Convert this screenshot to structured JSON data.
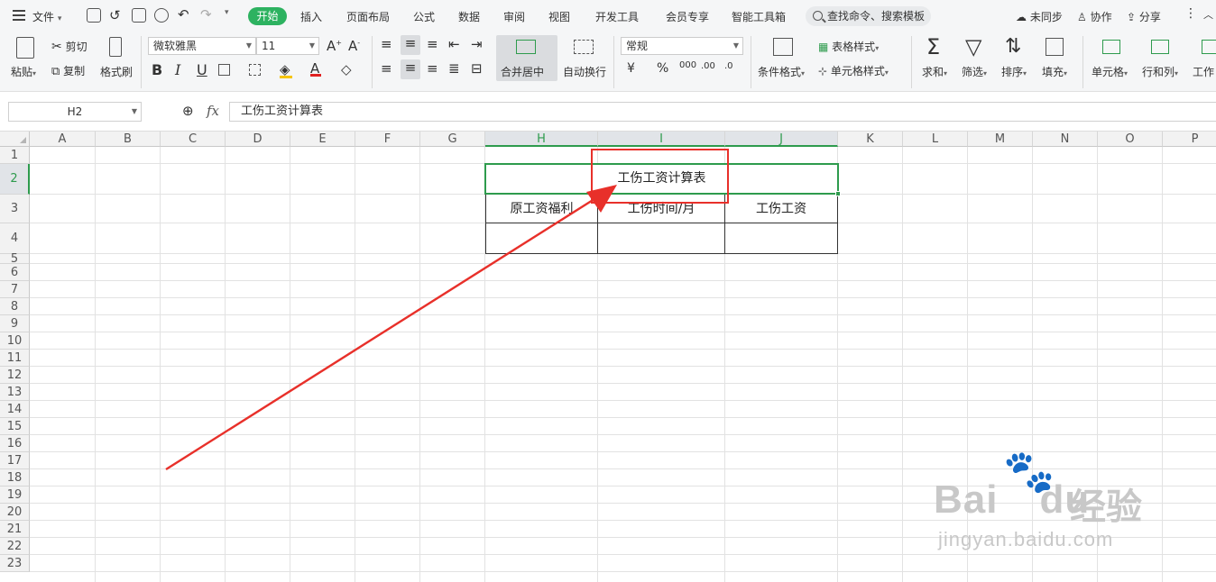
{
  "topbar": {
    "file_label": "文件",
    "tabs": [
      "开始",
      "插入",
      "页面布局",
      "公式",
      "数据",
      "审阅",
      "视图",
      "开发工具",
      "会员专享",
      "智能工具箱"
    ],
    "search_placeholder": "查找命令、搜索模板",
    "sync_label": "未同步",
    "collab_label": "协作",
    "share_label": "分享"
  },
  "ribbon": {
    "paste": "粘贴",
    "cut": "剪切",
    "copy": "复制",
    "format_painter": "格式刷",
    "font_name": "微软雅黑",
    "font_size": "11",
    "bold": "B",
    "italic": "I",
    "underline": "U",
    "merge_center": "合并居中",
    "wrap_text": "自动换行",
    "number_format": "常规",
    "currency": "¥",
    "percent": "%",
    "thousands": "000",
    "inc_decimal": ".00",
    "dec_decimal": ".0",
    "conditional_format": "条件格式",
    "table_style": "表格样式",
    "cell_style": "单元格样式",
    "sum": "求和",
    "filter": "筛选",
    "sort": "排序",
    "fill": "填充",
    "cell": "单元格",
    "row_col": "行和列",
    "worksheet": "工作"
  },
  "formula_bar": {
    "name_box": "H2",
    "fx": "fx",
    "value": "工伤工资计算表"
  },
  "sheet": {
    "columns": [
      "A",
      "B",
      "C",
      "D",
      "E",
      "F",
      "G",
      "H",
      "I",
      "J",
      "K",
      "L",
      "M",
      "N",
      "O",
      "P"
    ],
    "rows": [
      "1",
      "2",
      "3",
      "4",
      "5",
      "6",
      "7",
      "8",
      "9",
      "10",
      "11",
      "12",
      "13",
      "14",
      "15",
      "16",
      "17",
      "18",
      "19",
      "20",
      "21",
      "22",
      "23"
    ],
    "title_cell": "工伤工资计算表",
    "headers": [
      "原工资福利",
      "工伤时间/月",
      "工伤工资"
    ]
  },
  "watermark": {
    "brand_a": "Bai",
    "brand_b": "du",
    "brand_cn": "经验",
    "url": "jingyan.baidu.com"
  },
  "colors": {
    "accent": "#2db260",
    "selection": "#2e9b4d",
    "annotation": "#e8302a"
  }
}
